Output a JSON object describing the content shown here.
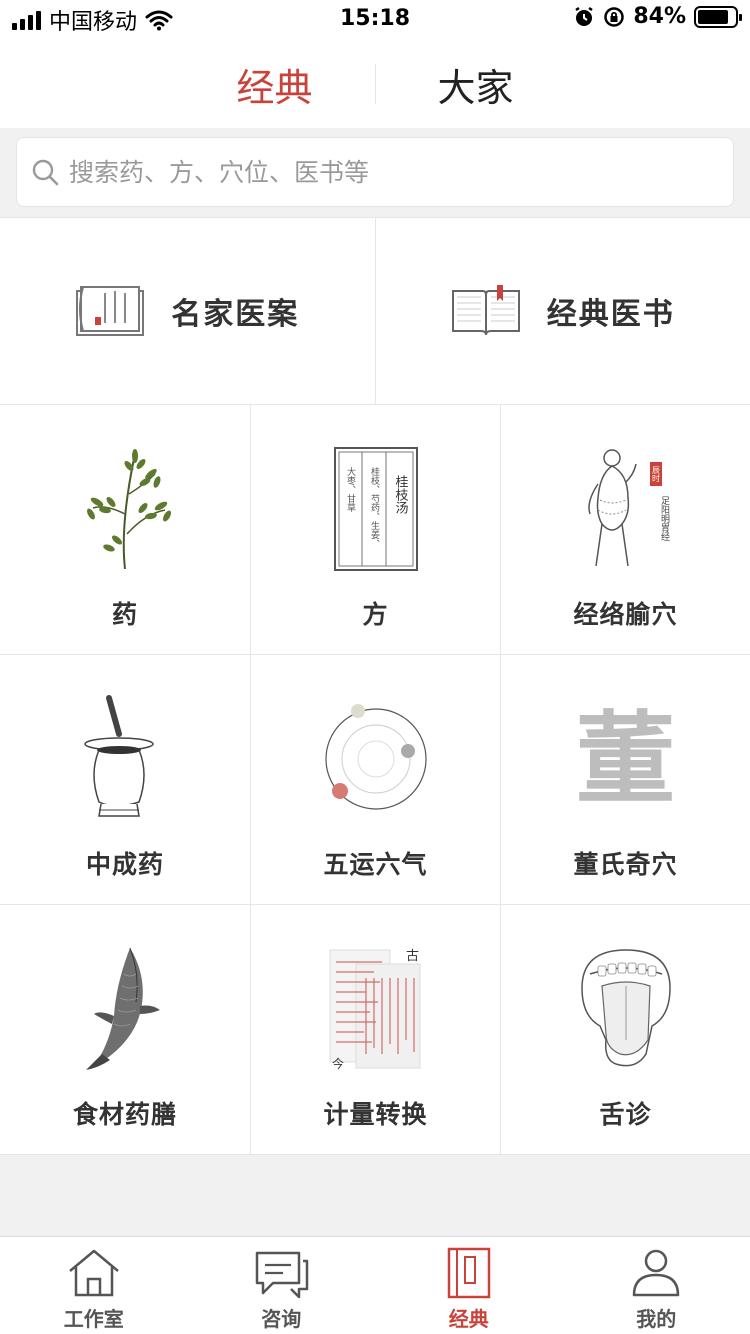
{
  "status_bar": {
    "carrier": "中国移动",
    "time": "15:18",
    "battery_pct": "84%",
    "battery_level": 0.84
  },
  "top_tabs": [
    {
      "label": "经典",
      "active": true
    },
    {
      "label": "大家",
      "active": false
    }
  ],
  "search": {
    "placeholder": "搜索药、方、穴位、医书等"
  },
  "featured": [
    {
      "label": "名家医案",
      "icon": "scroll-icon"
    },
    {
      "label": "经典医书",
      "icon": "open-book-icon"
    }
  ],
  "grid": [
    {
      "label": "药",
      "icon": "herb-icon"
    },
    {
      "label": "方",
      "icon": "prescription-card-icon"
    },
    {
      "label": "经络腧穴",
      "icon": "meridian-figure-icon"
    },
    {
      "label": "中成药",
      "icon": "mortar-jar-icon"
    },
    {
      "label": "五运六气",
      "icon": "orbit-icon"
    },
    {
      "label": "董氏奇穴",
      "icon": "dong-character-icon"
    },
    {
      "label": "食材药膳",
      "icon": "fish-icon"
    },
    {
      "label": "计量转换",
      "icon": "document-stack-icon"
    },
    {
      "label": "舌诊",
      "icon": "tongue-icon"
    }
  ],
  "fang_card": {
    "title": "桂枝汤",
    "line1": "桂枝、芍药、生姜、",
    "line2": "大枣、甘草"
  },
  "meridian_card": {
    "seal": "辰时",
    "text": "足阳明胃经"
  },
  "dong_char": "董",
  "measure_card": {
    "old": "古",
    "new": "今"
  },
  "bottom_nav": [
    {
      "label": "工作室",
      "icon": "house-icon",
      "active": false
    },
    {
      "label": "咨询",
      "icon": "chat-icon",
      "active": false
    },
    {
      "label": "经典",
      "icon": "book-icon",
      "active": true
    },
    {
      "label": "我的",
      "icon": "user-icon",
      "active": false
    }
  ],
  "colors": {
    "accent": "#c9433a",
    "divider": "#e6e6e6",
    "background_gray": "#f1f1f1"
  }
}
